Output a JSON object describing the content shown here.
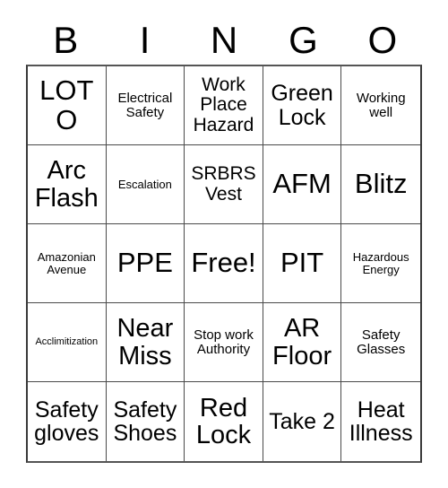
{
  "card": {
    "title": "BINGO",
    "header_letters": [
      "B",
      "I",
      "N",
      "G",
      "O"
    ],
    "rows": 5,
    "columns": 5,
    "free_space": "Free!",
    "free_space_index": 12,
    "colors": {
      "background": "#ffffff",
      "text": "#000000",
      "grid_line": "#4a4a4a",
      "grid_border": "#3a3a3a"
    },
    "cells": [
      {
        "text": "LOTO",
        "size": "size-xl",
        "column": "B",
        "row": 1
      },
      {
        "text": "Electrical Safety",
        "size": "size-xs",
        "column": "I",
        "row": 1
      },
      {
        "text": "Work Place Hazard",
        "size": "size-sm",
        "column": "N",
        "row": 1
      },
      {
        "text": "Green Lock",
        "size": "size-md",
        "column": "G",
        "row": 1
      },
      {
        "text": "Working well",
        "size": "size-xs",
        "column": "O",
        "row": 1
      },
      {
        "text": "Arc Flash",
        "size": "size-lg",
        "column": "B",
        "row": 2
      },
      {
        "text": "Escalation",
        "size": "size-xxs",
        "column": "I",
        "row": 2
      },
      {
        "text": "SRBRS Vest",
        "size": "size-sm",
        "column": "N",
        "row": 2
      },
      {
        "text": "AFM",
        "size": "size-xl",
        "column": "G",
        "row": 2
      },
      {
        "text": "Blitz",
        "size": "size-xl",
        "column": "O",
        "row": 2
      },
      {
        "text": "Amazonian Avenue",
        "size": "size-xxs",
        "column": "B",
        "row": 3
      },
      {
        "text": "PPE",
        "size": "size-xl",
        "column": "I",
        "row": 3
      },
      {
        "text": "Free!",
        "size": "size-xl",
        "column": "N",
        "row": 3
      },
      {
        "text": "PIT",
        "size": "size-xl",
        "column": "G",
        "row": 3
      },
      {
        "text": "Hazardous Energy",
        "size": "size-xxs",
        "column": "O",
        "row": 3
      },
      {
        "text": "Acclimitization",
        "size": "size-tiny",
        "column": "B",
        "row": 4
      },
      {
        "text": "Near Miss",
        "size": "size-lg",
        "column": "I",
        "row": 4
      },
      {
        "text": "Stop work Authority",
        "size": "size-xs",
        "column": "N",
        "row": 4
      },
      {
        "text": "AR Floor",
        "size": "size-lg",
        "column": "G",
        "row": 4
      },
      {
        "text": "Safety Glasses",
        "size": "size-xs",
        "column": "O",
        "row": 4
      },
      {
        "text": "Safety gloves",
        "size": "size-md",
        "column": "B",
        "row": 5
      },
      {
        "text": "Safety Shoes",
        "size": "size-md",
        "column": "I",
        "row": 5
      },
      {
        "text": "Red Lock",
        "size": "size-lg",
        "column": "N",
        "row": 5
      },
      {
        "text": "Take 2",
        "size": "size-md",
        "column": "G",
        "row": 5
      },
      {
        "text": "Heat Illness",
        "size": "size-md",
        "column": "O",
        "row": 5
      }
    ]
  }
}
